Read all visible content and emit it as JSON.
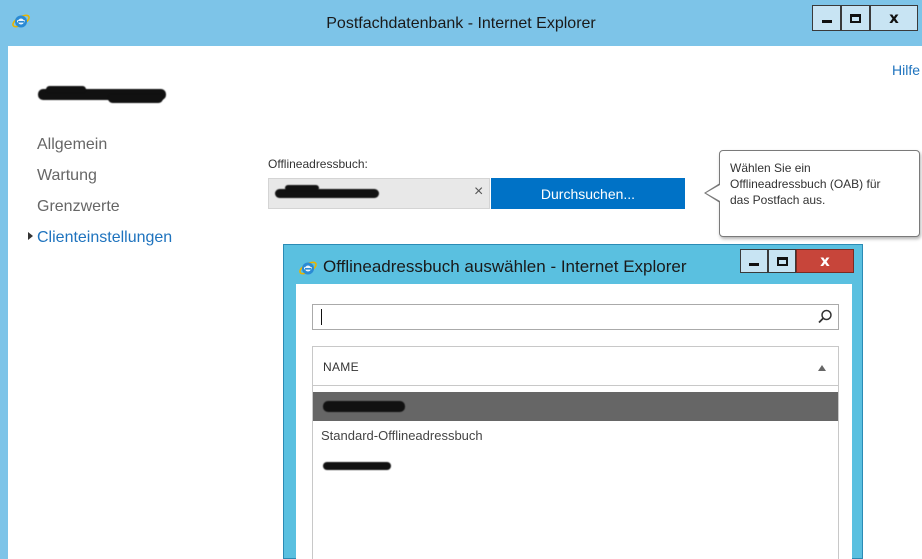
{
  "main_window": {
    "title": "Postfachdatenbank - Internet Explorer",
    "help_link": "Hilfe"
  },
  "nav": {
    "items": [
      {
        "label": "Allgemein"
      },
      {
        "label": "Wartung"
      },
      {
        "label": "Grenzwerte"
      },
      {
        "label": "Clienteinstellungen",
        "active": true
      }
    ]
  },
  "form": {
    "oab_label": "Offlineadressbuch:",
    "clear_glyph": "×",
    "browse_button": "Durchsuchen..."
  },
  "tooltip": {
    "text_line1": "Wählen Sie ein",
    "text_line2": "Offlineadressbuch (OAB) für",
    "text_line3": "das Postfach aus."
  },
  "dialog": {
    "title": "Offlineadressbuch auswählen - Internet Explorer",
    "search_value": "",
    "list_header": "NAME",
    "rows": [
      {
        "label": "",
        "selected": true
      },
      {
        "label": "Standard-Offlineadressbuch",
        "selected": false
      },
      {
        "label": "",
        "selected": false
      }
    ]
  },
  "colors": {
    "titlebar": "#7dc4e8",
    "dialog_frame": "#5ac0e0",
    "accent_blue": "#0072c6",
    "link_blue": "#1e73be",
    "selected_row": "#666666",
    "close_red": "#c7453a"
  },
  "icons": {
    "browser": "internet-explorer-icon",
    "search": "search-icon",
    "sort": "sort-ascending-icon"
  }
}
